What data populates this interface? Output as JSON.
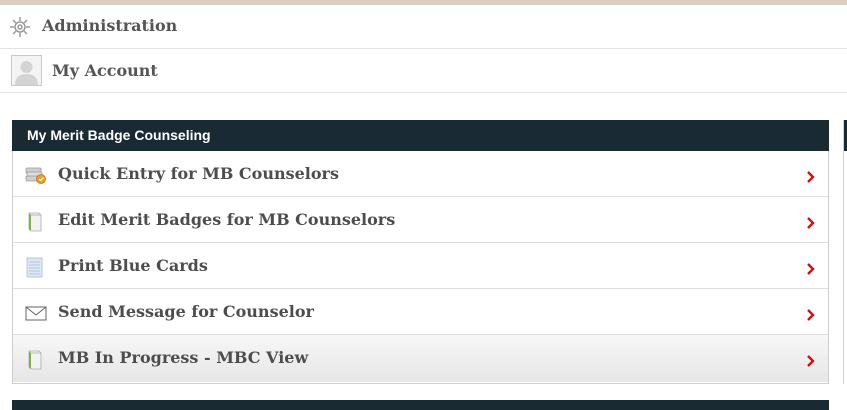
{
  "header": {
    "administration_label": "Administration",
    "account_label": "My Account"
  },
  "panel": {
    "title": "My Merit Badge Counseling",
    "items": [
      {
        "label": "Quick Entry for MB Counselors",
        "icon": "badge-stack-icon"
      },
      {
        "label": "Edit Merit Badges for MB Counselors",
        "icon": "book-icon"
      },
      {
        "label": "Print Blue Cards",
        "icon": "blue-card-icon"
      },
      {
        "label": "Send Message for Counselor",
        "icon": "envelope-icon"
      },
      {
        "label": "MB In Progress - MBC View",
        "icon": "book-icon"
      }
    ]
  },
  "colors": {
    "header_bg": "#1a2a33",
    "chevron": "#cc1111",
    "text": "#4d4d4d"
  }
}
